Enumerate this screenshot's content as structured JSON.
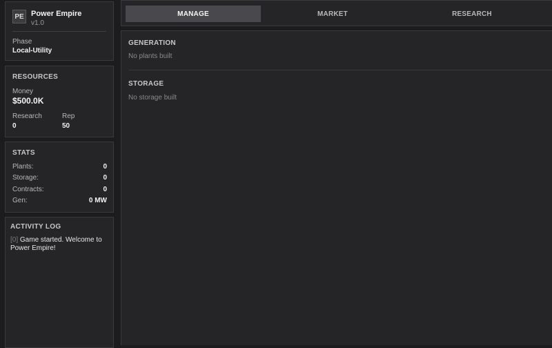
{
  "app": {
    "logo_text": "PE",
    "title": "Power Empire",
    "version": "v1.0",
    "phase_label": "Phase",
    "phase_value": "Local-Utility"
  },
  "resources": {
    "heading": "RESOURCES",
    "money_label": "Money",
    "money_value": "$500.0K",
    "research_label": "Research",
    "research_value": "0",
    "rep_label": "Rep",
    "rep_value": "50"
  },
  "stats": {
    "heading": "STATS",
    "rows": [
      {
        "label": "Plants:",
        "value": "0"
      },
      {
        "label": "Storage:",
        "value": "0"
      },
      {
        "label": "Contracts:",
        "value": "0"
      },
      {
        "label": "Gen:",
        "value": "0 MW"
      }
    ]
  },
  "activity_log": {
    "heading": "ACTIVITY LOG",
    "entries": [
      {
        "time": "[0]",
        "text": "Game started. Welcome to Power Empire!"
      }
    ]
  },
  "tabs": [
    {
      "label": "MANAGE",
      "active": true
    },
    {
      "label": "MARKET",
      "active": false
    },
    {
      "label": "RESEARCH",
      "active": false
    }
  ],
  "main": {
    "generation_heading": "GENERATION",
    "generation_empty": "No plants built",
    "storage_heading": "STORAGE",
    "storage_empty": "No storage built"
  },
  "colors": {
    "background": "#1c1c1e",
    "panel": "#252527",
    "active_tab": "#49494d"
  }
}
